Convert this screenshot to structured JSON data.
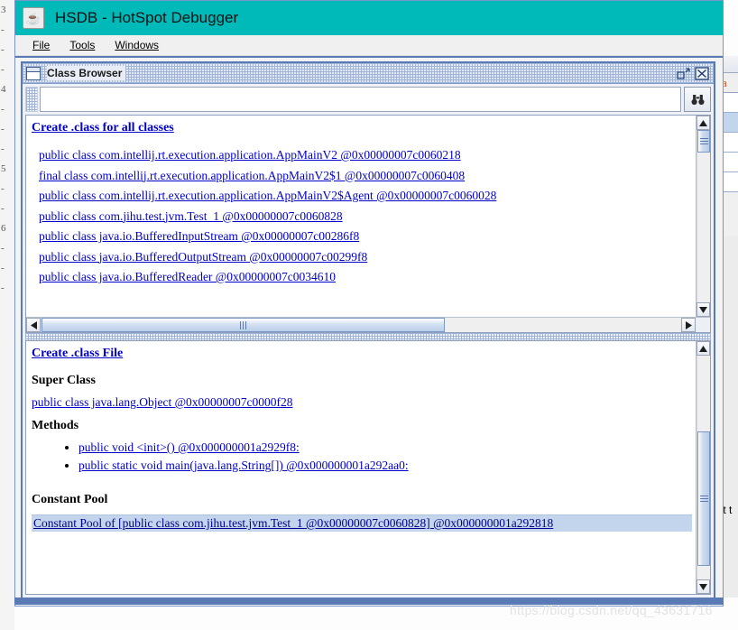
{
  "app": {
    "title": "HSDB - HotSpot Debugger",
    "icon": "java-cup-icon",
    "titlebar_color": "#00b9b9"
  },
  "menubar": {
    "items": [
      {
        "label": "File",
        "mnemonic": "F"
      },
      {
        "label": "Tools",
        "mnemonic": "T"
      },
      {
        "label": "Windows",
        "mnemonic": "W"
      }
    ]
  },
  "internal_frame": {
    "title": "Class Browser",
    "icon": "window-icon",
    "buttons": {
      "restore": "restore-icon",
      "close": "close-icon"
    }
  },
  "search": {
    "value": "",
    "placeholder": "",
    "button_icon": "binoculars-icon",
    "button_label": "🔭"
  },
  "top_pane": {
    "header_link": "Create .class for all classes",
    "classes": [
      "public class com.intellij.rt.execution.application.AppMainV2 @0x00000007c0060218",
      "final class com.intellij.rt.execution.application.AppMainV2$1 @0x00000007c0060408",
      "public class com.intellij.rt.execution.application.AppMainV2$Agent @0x00000007c0060028",
      "public class com.jihu.test.jvm.Test_1 @0x00000007c0060828",
      "public class java.io.BufferedInputStream @0x00000007c00286f8",
      "public class java.io.BufferedOutputStream @0x00000007c00299f8",
      "public class java.io.BufferedReader @0x00000007c0034610"
    ]
  },
  "bottom_pane": {
    "header_link": "Create .class File",
    "super_class_heading": "Super Class",
    "super_class_link": "public class java.lang.Object @0x00000007c0000f28",
    "methods_heading": "Methods",
    "methods": [
      "public void <init>() @0x000000001a2929f8:",
      "public static void main(java.lang.String[]) @0x000000001a292aa0:"
    ],
    "constant_pool_heading": "Constant Pool",
    "constant_pool_link": "Constant Pool of [public class com.jihu.test.jvm.Test_1 @0x00000007c0060828] @0x000000001a292818",
    "selection_color": "#c3d5ec"
  },
  "scrollbars": {
    "top_vertical": {
      "up": "▲",
      "down": "▼",
      "thumb_top_pct": 0,
      "thumb_height_pct": 13
    },
    "top_horizontal": {
      "left": "◀",
      "right": "▶",
      "thumb_left_pct": 0,
      "thumb_width_pct": 63
    },
    "bottom_vertical": {
      "up": "▲",
      "down": "▼",
      "thumb_top_pct": 34,
      "thumb_height_pct": 60
    }
  },
  "background": {
    "right_table_header": "Ja",
    "right_text": "ent t",
    "left_lines": [
      "3",
      "-",
      "-",
      "-",
      "4",
      "-",
      "-",
      "-",
      "5",
      "-",
      "-",
      "6",
      "-",
      "-",
      "-"
    ]
  },
  "watermark": "https://blog.csdn.net/qq_43631716"
}
